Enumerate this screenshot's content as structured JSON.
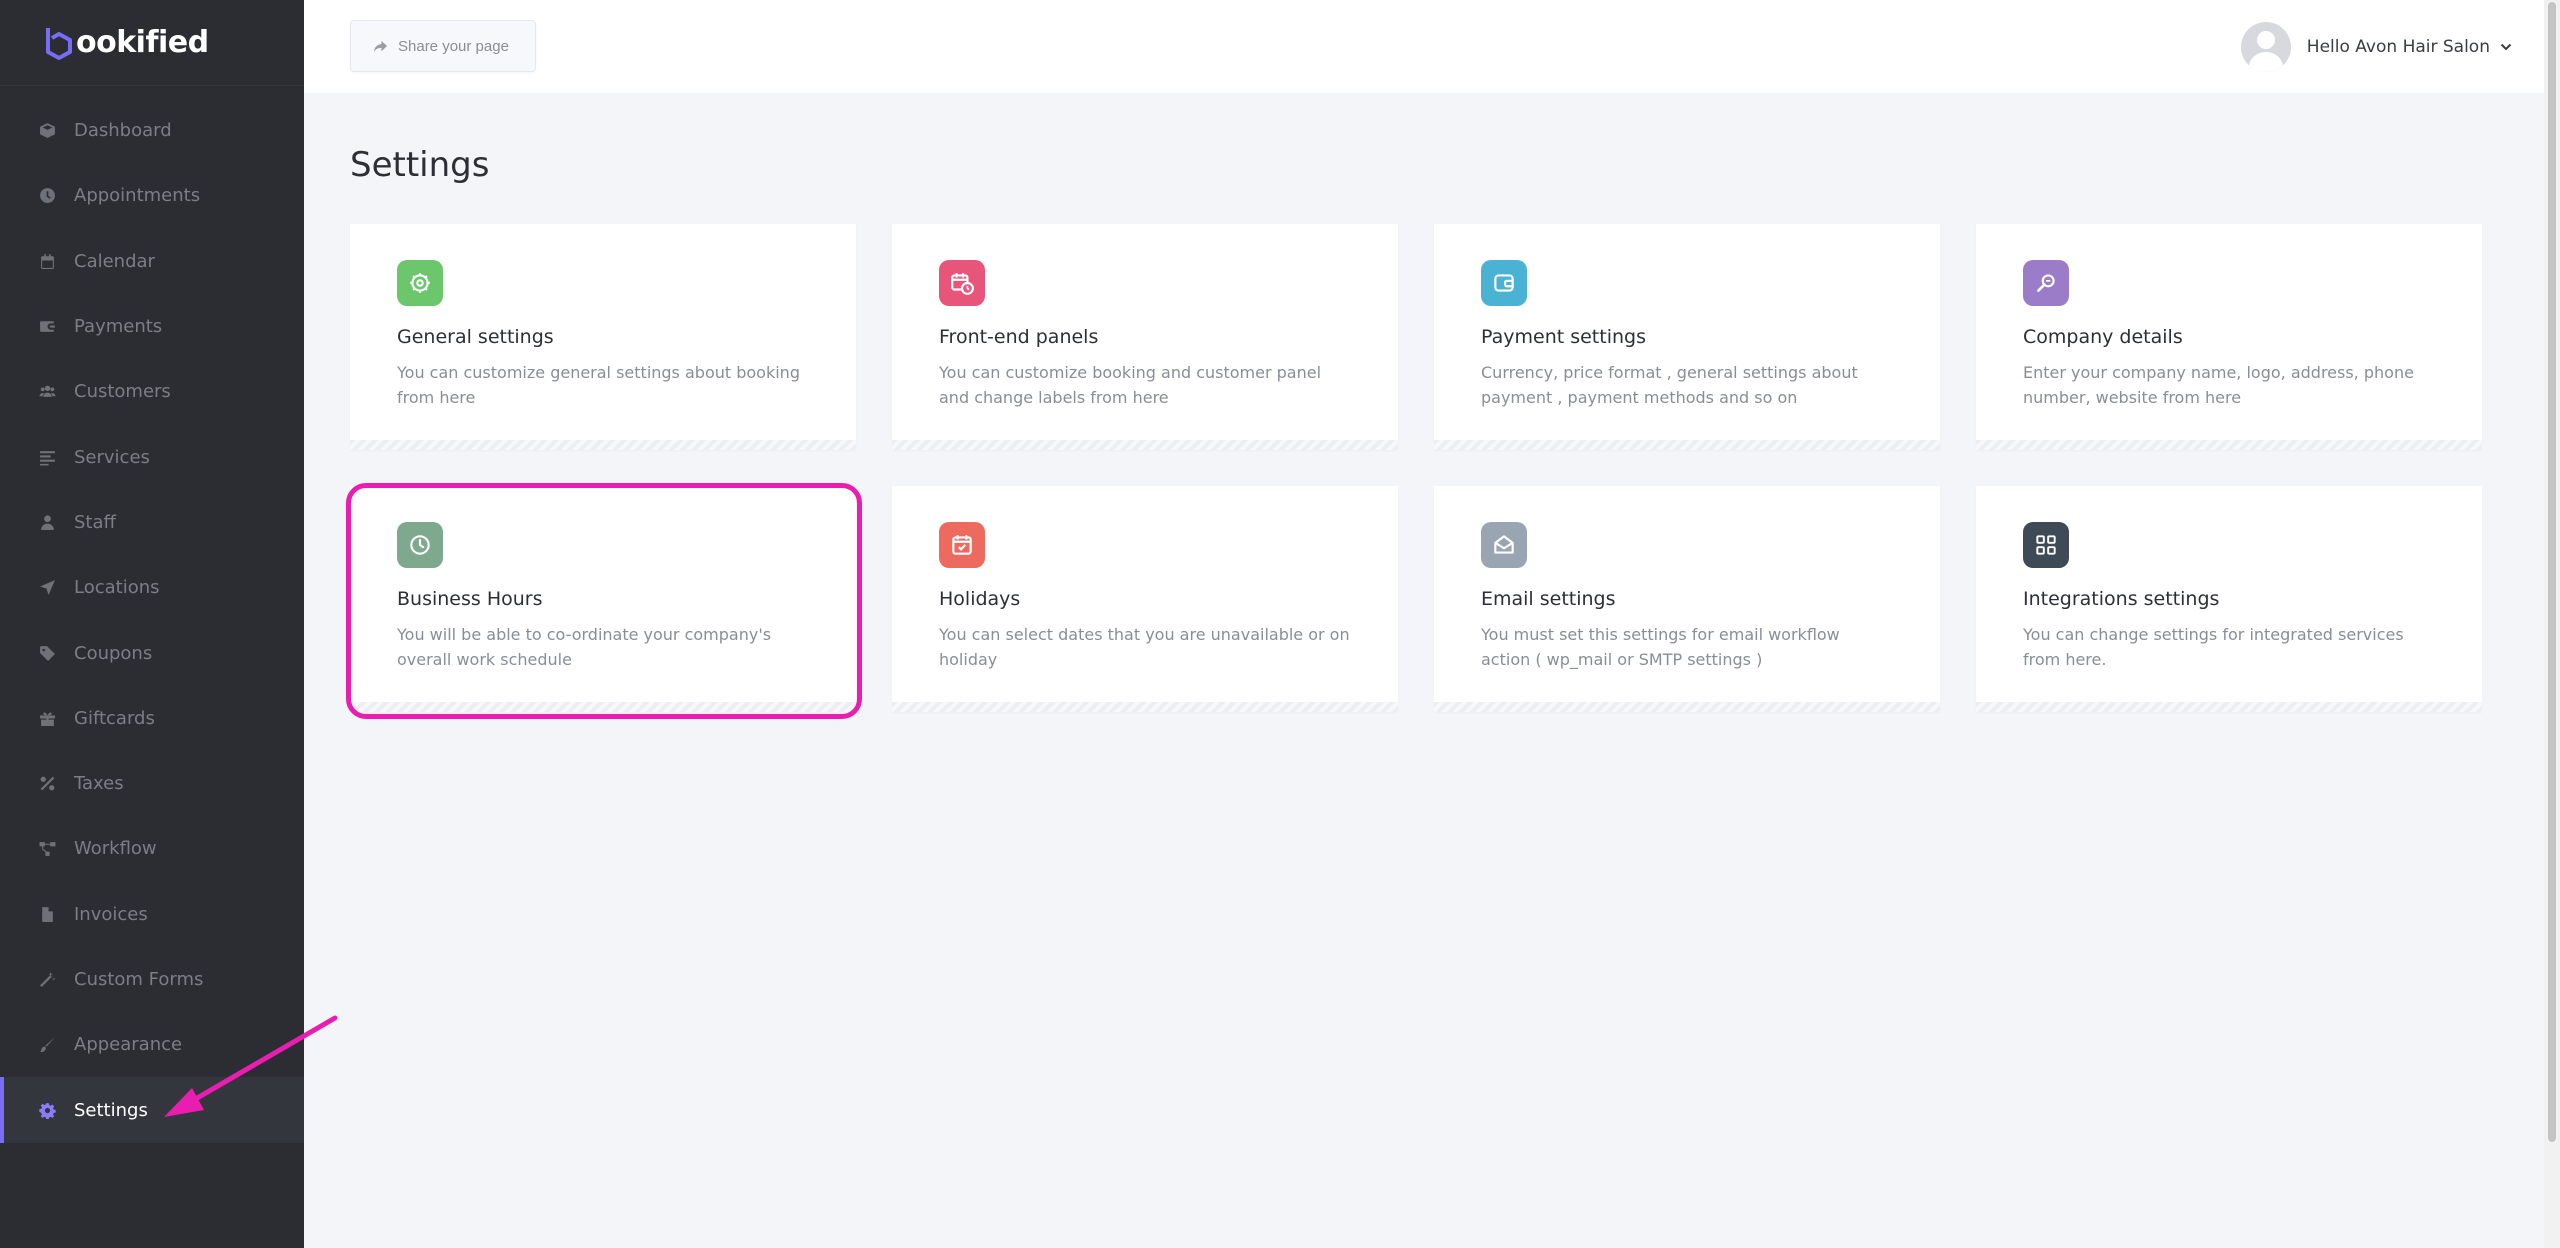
{
  "brand": {
    "logo_text": "ookified",
    "accent": "#7b6cf6"
  },
  "sidebar": {
    "items": [
      {
        "label": "Dashboard",
        "icon": "cube-icon"
      },
      {
        "label": "Appointments",
        "icon": "clock-icon"
      },
      {
        "label": "Calendar",
        "icon": "calendar-icon"
      },
      {
        "label": "Payments",
        "icon": "wallet-icon"
      },
      {
        "label": "Customers",
        "icon": "users-icon"
      },
      {
        "label": "Services",
        "icon": "list-icon"
      },
      {
        "label": "Staff",
        "icon": "user-icon"
      },
      {
        "label": "Locations",
        "icon": "location-arrow-icon"
      },
      {
        "label": "Coupons",
        "icon": "tag-icon"
      },
      {
        "label": "Giftcards",
        "icon": "gift-icon"
      },
      {
        "label": "Taxes",
        "icon": "percent-icon"
      },
      {
        "label": "Workflow",
        "icon": "workflow-icon"
      },
      {
        "label": "Invoices",
        "icon": "file-icon"
      },
      {
        "label": "Custom Forms",
        "icon": "magic-wand-icon"
      },
      {
        "label": "Appearance",
        "icon": "brush-icon"
      },
      {
        "label": "Settings",
        "icon": "gear-icon",
        "active": true
      }
    ]
  },
  "topbar": {
    "share_label": "Share your page",
    "user_greeting": "Hello Avon Hair Salon"
  },
  "main": {
    "title": "Settings",
    "cards": [
      {
        "title": "General settings",
        "desc": "You can customize general settings about booking from here",
        "icon": "gear-icon",
        "color": "#6cc66c"
      },
      {
        "title": "Front-end panels",
        "desc": "You can customize booking and customer panel and change labels from here",
        "icon": "calendar-clock-icon",
        "color": "#e8557a"
      },
      {
        "title": "Payment settings",
        "desc": "Currency, price format , general settings about payment , payment methods and so on",
        "icon": "wallet-icon",
        "color": "#4ab3d3"
      },
      {
        "title": "Company details",
        "desc": "Enter your company name, logo, address, phone number, website from here",
        "icon": "magnifier-icon",
        "color": "#9b7cc8"
      },
      {
        "title": "Business Hours",
        "desc": "You will be able to co-ordinate your company's overall work schedule",
        "icon": "clock-icon",
        "color": "#7fa98d"
      },
      {
        "title": "Holidays",
        "desc": "You can select dates that you are unavailable or on holiday",
        "icon": "calendar-check-icon",
        "color": "#ec6b5e"
      },
      {
        "title": "Email settings",
        "desc": "You must set this settings for email workflow action ( wp_mail or SMTP settings )",
        "icon": "envelope-open-icon",
        "color": "#9aa5b3"
      },
      {
        "title": "Integrations settings",
        "desc": "You can change settings for integrated services from here.",
        "icon": "puzzle-grid-icon",
        "color": "#3e4a56"
      }
    ]
  },
  "annotations": {
    "highlight_color": "#e91eb0"
  }
}
